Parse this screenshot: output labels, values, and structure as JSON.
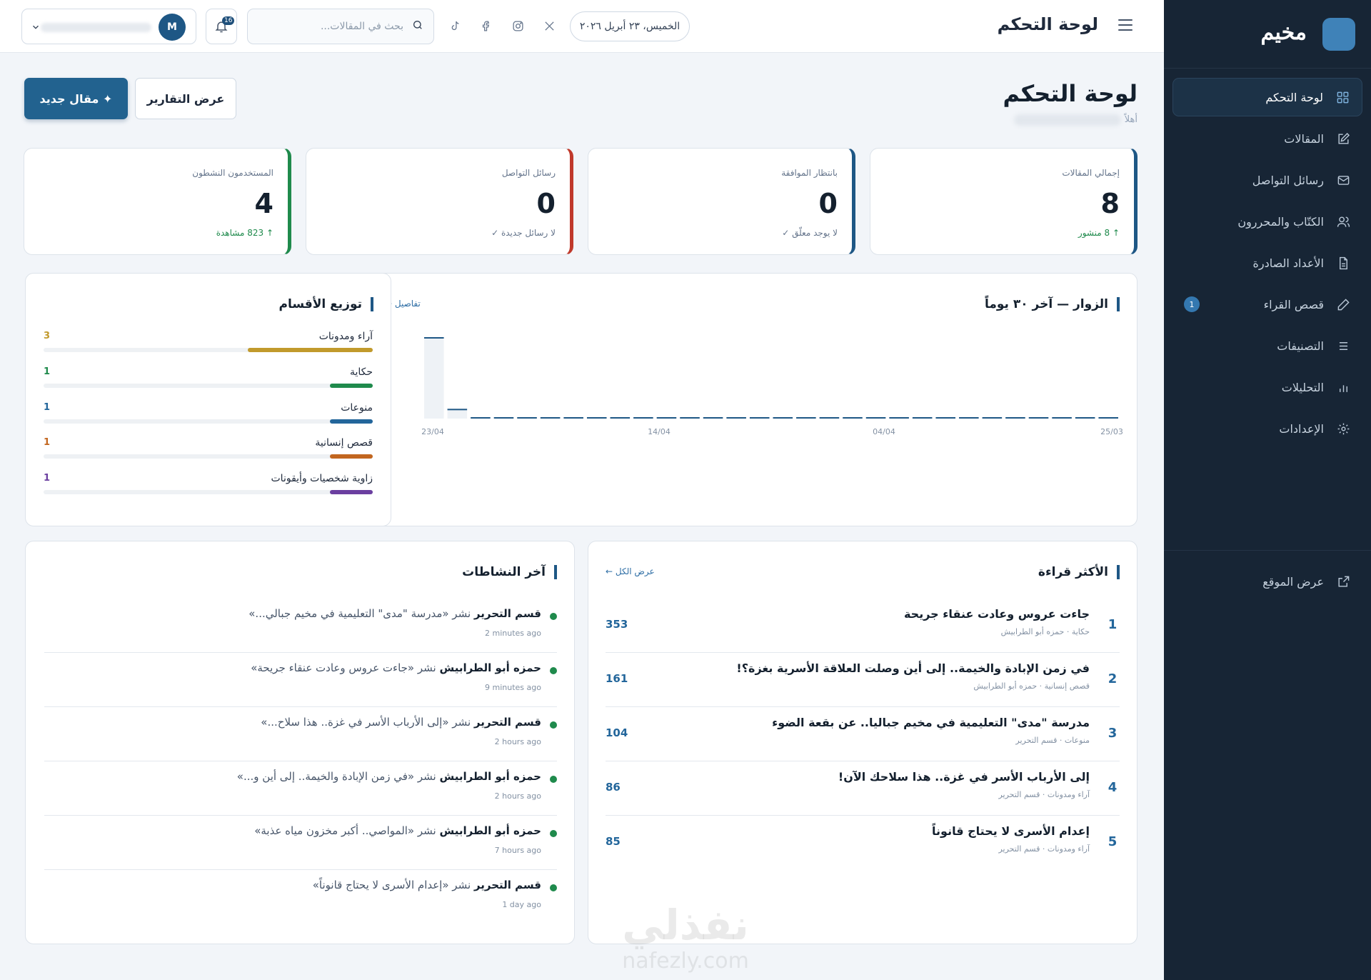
{
  "sidebar": {
    "brand": "مخيم",
    "items": [
      {
        "label": "لوحة التحكم",
        "icon": "grid-icon",
        "active": true
      },
      {
        "label": "المقالات",
        "icon": "edit-icon"
      },
      {
        "label": "رسائل التواصل",
        "icon": "mail-icon"
      },
      {
        "label": "الكتّاب والمحررون",
        "icon": "users-icon"
      },
      {
        "label": "الأعداد الصادرة",
        "icon": "file-icon"
      },
      {
        "label": "قصص القراء",
        "icon": "pen-icon",
        "badge": "1"
      },
      {
        "label": "التصنيفات",
        "icon": "list-icon"
      },
      {
        "label": "التحليلات",
        "icon": "bar-chart-icon"
      },
      {
        "label": "الإعدادات",
        "icon": "gear-icon"
      }
    ],
    "bottom": {
      "label": "عرض الموقع",
      "icon": "external-link-icon"
    }
  },
  "topbar": {
    "title": "لوحة التحكم",
    "date": "الخميس، ٢٣ أبريل ٢٠٢٦",
    "search_placeholder": "بحث في المقالات...",
    "notifications": "16",
    "user_initial": "M",
    "socials": [
      "tiktok-icon",
      "facebook-icon",
      "instagram-icon",
      "x-icon"
    ]
  },
  "page": {
    "title": "لوحة التحكم",
    "greeting": "أهلاً",
    "reports_button": "عرض التقارير",
    "new_button": "✦ مقال جديد"
  },
  "stats": [
    {
      "label": "إجمالي المقالات",
      "value": "8",
      "sub": "↑ 8 منشور",
      "sub_color": "green",
      "accent": "#1e5785"
    },
    {
      "label": "بانتظار الموافقة",
      "value": "0",
      "sub": "لا يوجد معلّق ✓",
      "sub_color": "gray",
      "accent": "#1e5785"
    },
    {
      "label": "رسائل التواصل",
      "value": "0",
      "sub": "لا رسائل جديدة ✓",
      "sub_color": "gray",
      "accent": "#c0392b"
    },
    {
      "label": "المستخدمون النشطون",
      "value": "4",
      "sub": "↑ 823 مشاهدة",
      "sub_color": "green",
      "accent": "#1f8a4c"
    }
  ],
  "visitors": {
    "title": "الزوار — آخر ٣٠ يوماً",
    "link": "تفاصيل ←"
  },
  "chart_data": {
    "type": "bar",
    "title": "الزوار — آخر ٣٠ يوماً",
    "x_tick_labels": [
      "25/03",
      "04/04",
      "14/04",
      "23/04"
    ],
    "values": [
      0,
      0,
      0,
      0,
      0,
      0,
      0,
      0,
      0,
      0,
      0,
      0,
      0,
      0,
      0,
      0,
      0,
      0,
      0,
      0,
      0,
      0,
      0,
      0,
      0,
      0,
      0,
      0,
      12,
      100
    ],
    "ylim": [
      0,
      100
    ],
    "grid": false,
    "bar_color": "#1e5785"
  },
  "categories": {
    "title": "توزيع الأقسام",
    "items": [
      {
        "name": "آراء ومدونات",
        "count": "3",
        "fraction": 0.38,
        "color": "#c19a2c"
      },
      {
        "name": "حكاية",
        "count": "1",
        "fraction": 0.13,
        "color": "#1f8a4c"
      },
      {
        "name": "منوعات",
        "count": "1",
        "fraction": 0.13,
        "color": "#23669b"
      },
      {
        "name": "قصص إنسانية",
        "count": "1",
        "fraction": 0.13,
        "color": "#c2661f"
      },
      {
        "name": "زاوية شخصيات وأيقونات",
        "count": "1",
        "fraction": 0.13,
        "color": "#6b3fa0"
      }
    ]
  },
  "most_read": {
    "title": "الأكثر قراءة",
    "link": "عرض الكل ←",
    "items": [
      {
        "rank": "1",
        "title": "جاءت عروس وعادت عنقاء جريحة",
        "meta": "حكاية · حمزه أبو الطرابيش",
        "views": "353"
      },
      {
        "rank": "2",
        "title": "في زمن الإبادة والخيمة.. إلى أين وصلت العلاقة الأسرية بغزة؟!",
        "meta": "قصص إنسانية · حمزه أبو الطرابيش",
        "views": "161"
      },
      {
        "rank": "3",
        "title": "مدرسة \"مدى\" التعليمية في مخيم جباليا.. عن بقعة الضوء",
        "meta": "منوعات · قسم التحرير",
        "views": "104"
      },
      {
        "rank": "4",
        "title": "إلى الأرباب الأسر في غزة.. هذا سلاحك الآن!",
        "meta": "آراء ومدونات · قسم التحرير",
        "views": "86"
      },
      {
        "rank": "5",
        "title": "إعدام الأسرى لا يحتاج قانوناً",
        "meta": "آراء ومدونات · قسم التحرير",
        "views": "85"
      }
    ]
  },
  "activity": {
    "title": "آخر النشاطات",
    "items": [
      {
        "actor": "قسم التحرير",
        "text": "نشر «مدرسة \"مدى\" التعليمية في مخيم جبالي...»",
        "time": "2 minutes ago"
      },
      {
        "actor": "حمزه أبو الطرابيش",
        "text": "نشر «جاءت عروس وعادت عنقاء جريحة»",
        "time": "9 minutes ago"
      },
      {
        "actor": "قسم التحرير",
        "text": "نشر «إلى الأرباب الأسر في غزة.. هذا سلاح...»",
        "time": "2 hours ago"
      },
      {
        "actor": "حمزه أبو الطرابيش",
        "text": "نشر «في زمن الإبادة والخيمة.. إلى أين و...»",
        "time": "2 hours ago"
      },
      {
        "actor": "حمزه أبو الطرابيش",
        "text": "نشر «المواصي.. أكبر مخزون مياه عذبة»",
        "time": "7 hours ago"
      },
      {
        "actor": "قسم التحرير",
        "text": "نشر «إعدام الأسرى لا يحتاج قانوناً»",
        "time": "1 day ago"
      }
    ]
  },
  "watermark": {
    "ar": "نفذلي",
    "en": "nafezly.com"
  }
}
